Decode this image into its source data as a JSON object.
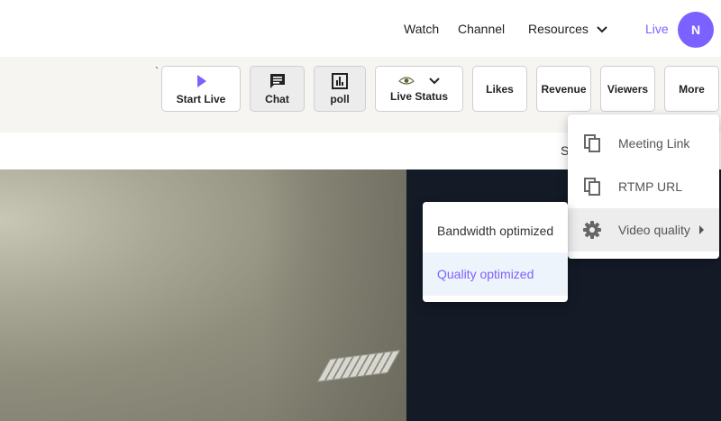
{
  "nav": {
    "links": [
      "Watch",
      "Channel",
      "Resources"
    ],
    "live_label": "Live",
    "avatar_initial": "N",
    "accent_color": "#7b61ff"
  },
  "toolbar": {
    "tick_mark": "`",
    "buttons": [
      {
        "label": "Start Live",
        "icon": "play-icon"
      },
      {
        "label": "Chat",
        "icon": "chat-icon"
      },
      {
        "label": "poll",
        "icon": "poll-icon"
      },
      {
        "label": "Live Status",
        "icon": "eye-icon"
      },
      {
        "label": "Likes"
      },
      {
        "label": "Revenue"
      },
      {
        "label": "Viewers"
      },
      {
        "label": "More"
      }
    ]
  },
  "subbar": {
    "text": "S"
  },
  "more_menu": {
    "items": [
      {
        "label": "Meeting Link",
        "icon": "copy-icon"
      },
      {
        "label": "RTMP URL",
        "icon": "copy-icon"
      },
      {
        "label": "Video quality",
        "icon": "gear-icon"
      }
    ]
  },
  "quality_menu": {
    "items": [
      {
        "label": "Bandwidth optimized"
      },
      {
        "label": "Quality optimized",
        "selected": true
      }
    ]
  }
}
